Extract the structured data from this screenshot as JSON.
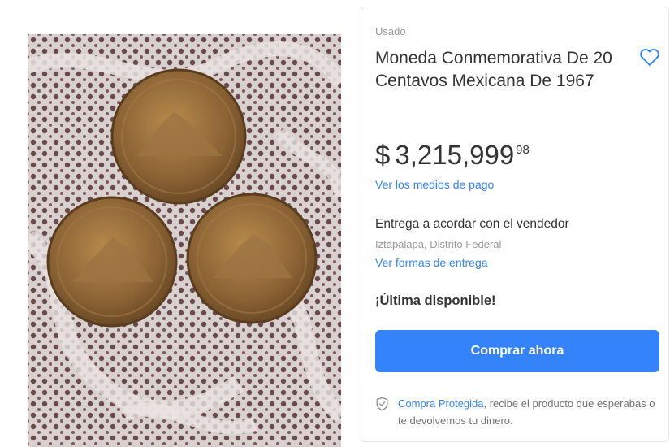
{
  "product": {
    "condition": "Usado",
    "title": "Moneda Conmemorativa De 20 Centavos Mexicana De 1967",
    "price": {
      "currency": "$",
      "amount": "3,215,999",
      "cents": "98"
    },
    "payment_link": "Ver los medios de pago",
    "delivery_text": "Entrega a acordar con el vendedor",
    "location": "Iztapalapa, Distrito Federal",
    "delivery_link": "Ver formas de entrega",
    "stock": "¡Última disponible!",
    "buy_button": "Comprar ahora",
    "protection": {
      "link": "Compra Protegida",
      "text": ", recibe el producto que esperabas o te devolvemos tu dinero."
    }
  },
  "icons": {
    "favorite": "heart-icon",
    "protection": "shield-check-icon"
  },
  "colors": {
    "accent": "#3483fa",
    "text": "#333333",
    "muted": "#999999"
  }
}
